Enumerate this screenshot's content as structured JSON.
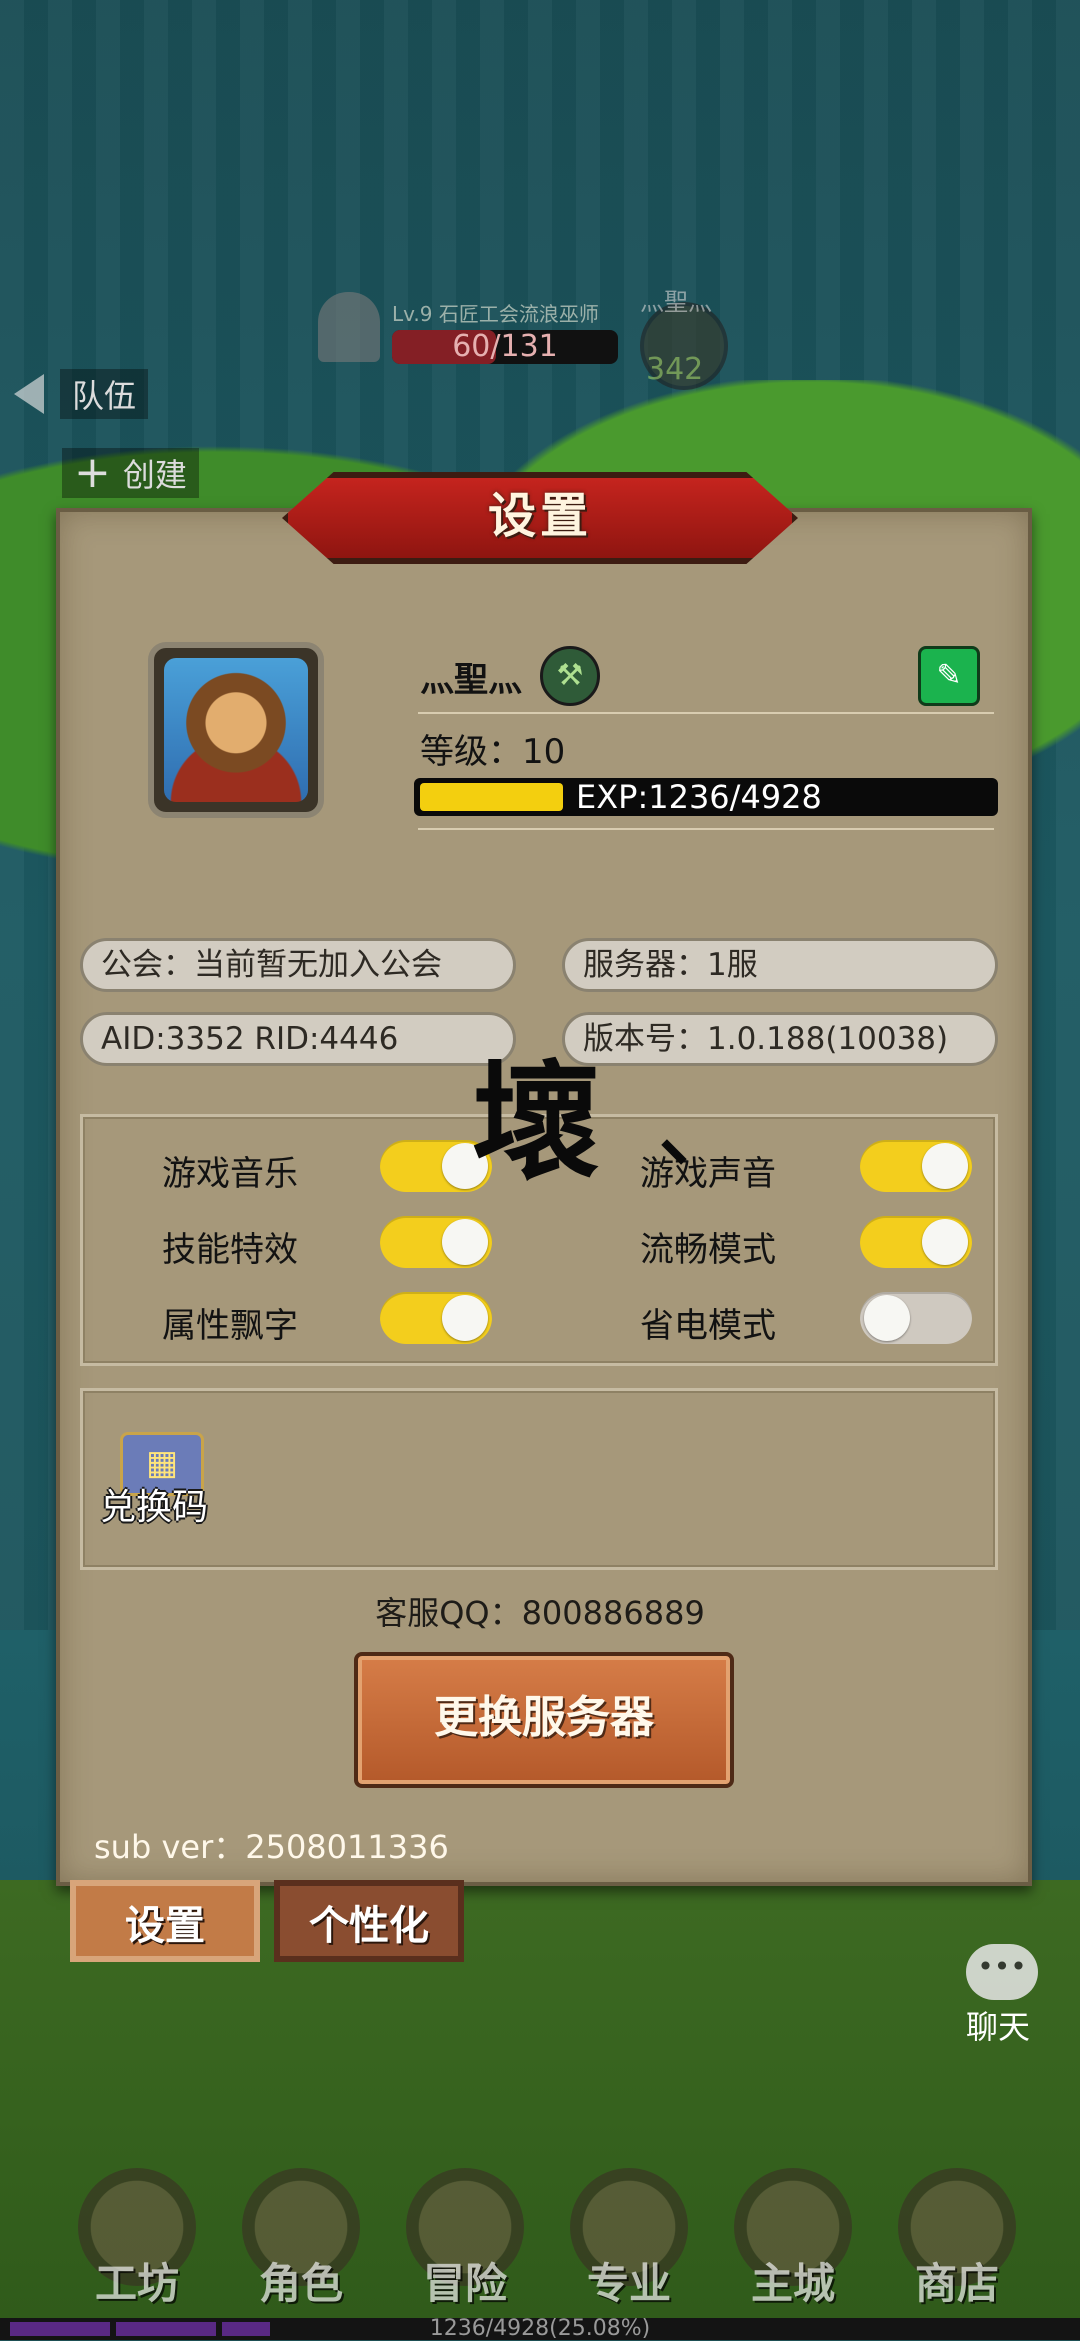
{
  "background": {
    "top_player": {
      "name": "Lv.9 石匠工会流浪巫师",
      "hp": "60/131",
      "hp_fraction": 0.46
    },
    "enemy": {
      "name": "灬聖灬",
      "number": "342"
    },
    "team_label": "队伍",
    "create_label": "创建",
    "chat_label": "聊天",
    "bottom_nav": [
      "工坊",
      "角色",
      "冒险",
      "专业",
      "主城",
      "商店"
    ],
    "exp_bar_text": "1236/4928(25.08%)"
  },
  "dialog": {
    "title": "设置",
    "player_name": "灬聖灬",
    "level_label": "等级：",
    "level_value": "10",
    "exp_text": "EXP:1236/4928",
    "exp_fraction": 0.25,
    "guild": "公会：当前暂无加入公会",
    "server": "服务器：1服",
    "ids": "AID:3352   RID:4446",
    "version": "版本号：1.0.188(10038)",
    "overlay_char": "壞",
    "toggles": {
      "music": {
        "label": "游戏音乐",
        "on": true
      },
      "sound": {
        "label": "游戏声音",
        "on": true
      },
      "skill_fx": {
        "label": "技能特效",
        "on": true
      },
      "smooth": {
        "label": "流畅模式",
        "on": true
      },
      "attr_float": {
        "label": "属性飘字",
        "on": true
      },
      "power_save": {
        "label": "省电模式",
        "on": false
      }
    },
    "redeem_label": "兑换码",
    "qq": "客服QQ：800886889",
    "change_server": "更换服务器",
    "sub_ver": "sub ver：2508011336"
  },
  "tabs": {
    "settings": "设置",
    "personalize": "个性化"
  },
  "colors": {
    "switch_on": "#f3ce1d",
    "switch_off": "#cfc9c0",
    "title_red": "#c5241e",
    "exp_yellow": "#f3cf0f"
  },
  "icons": [
    "pencil-edit-icon",
    "guild-crest-icon",
    "redeem-chest-icon",
    "chat-bubble-icon",
    "back-arrow-icon",
    "plus-icon"
  ]
}
